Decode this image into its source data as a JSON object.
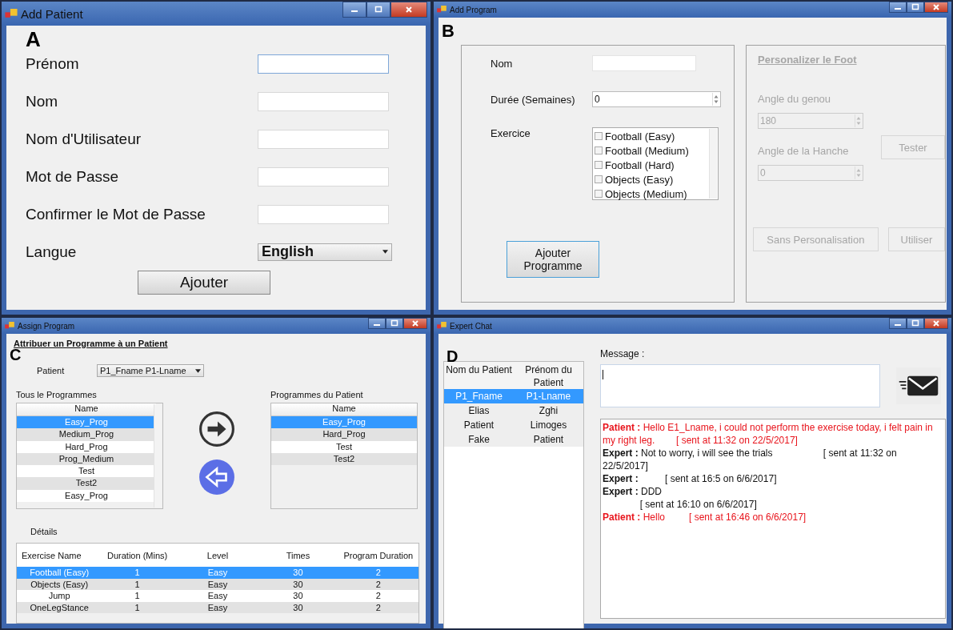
{
  "add_patient": {
    "window": {
      "title": "Add Patient"
    },
    "letter": "A",
    "fields": [
      {
        "label": "Prénom",
        "focused": true
      },
      {
        "label": "Nom",
        "focused": false
      },
      {
        "label": "Nom d'Utilisateur",
        "focused": false
      },
      {
        "label": "Mot de Passe",
        "focused": false
      },
      {
        "label": "Confirmer le Mot de Passe",
        "focused": false
      }
    ],
    "language": {
      "label": "Langue",
      "value": "English"
    },
    "button": "Ajouter"
  },
  "add_program": {
    "window": {
      "title": "Add Program"
    },
    "letter": "B",
    "name_label": "Nom",
    "duration": {
      "label": "Durée (Semaines)",
      "value": "0"
    },
    "exercises": {
      "label": "Exercice",
      "items": [
        {
          "label": "Football (Easy)",
          "checked": false
        },
        {
          "label": "Football (Medium)",
          "checked": false
        },
        {
          "label": "Football (Hard)",
          "checked": false
        },
        {
          "label": "Objects (Easy)",
          "checked": false
        },
        {
          "label": "Objects (Medium)",
          "checked": false
        }
      ]
    },
    "button": "Ajouter Programme",
    "custom": {
      "disabled": true,
      "title": "Personalizer le Foot",
      "knee_label": "Angle du genou",
      "knee_value": "180",
      "hip_label": "Angle de la Hanche",
      "hip_value": "0",
      "test_button": "Tester",
      "plain_button": "Sans Personalisation",
      "use_button": "Utiliser"
    }
  },
  "assign_program": {
    "window": {
      "title": "Assign Program"
    },
    "letter": "C",
    "heading": "Attribuer un Programme à un Patient",
    "patient": {
      "label": "Patient",
      "value": "P1_Fname P1-Lname"
    },
    "all_programs": {
      "title": "Tous le Programmes",
      "header": "Name",
      "rows": [
        {
          "name": "Easy_Prog",
          "selected": true
        },
        {
          "name": "Medium_Prog",
          "selected": false
        },
        {
          "name": "Hard_Prog",
          "selected": false
        },
        {
          "name": "Prog_Medium",
          "selected": false
        },
        {
          "name": "Test",
          "selected": false
        },
        {
          "name": "Test2",
          "selected": false
        },
        {
          "name": "Easy_Prog",
          "selected": false
        }
      ]
    },
    "patient_programs": {
      "title": "Programmes du Patient",
      "header": "Name",
      "rows": [
        {
          "name": "Easy_Prog",
          "selected": true
        },
        {
          "name": "Hard_Prog",
          "selected": false
        },
        {
          "name": "Test",
          "selected": false
        },
        {
          "name": "Test2",
          "selected": false
        }
      ]
    },
    "details": {
      "title": "Détails",
      "columns": [
        "Exercise Name",
        "Duration (Mins)",
        "Level",
        "Times",
        "Program Duration"
      ],
      "rows": [
        {
          "cells": [
            "Football (Easy)",
            "1",
            "Easy",
            "30",
            "2"
          ],
          "selected": true
        },
        {
          "cells": [
            "Objects (Easy)",
            "1",
            "Easy",
            "30",
            "2"
          ],
          "selected": false
        },
        {
          "cells": [
            "Jump",
            "1",
            "Easy",
            "30",
            "2"
          ],
          "selected": false
        },
        {
          "cells": [
            "OneLegStance",
            "1",
            "Easy",
            "30",
            "2"
          ],
          "selected": false
        }
      ]
    }
  },
  "expert_chat": {
    "window": {
      "title": "Expert Chat"
    },
    "letter": "D",
    "patients": {
      "columns": [
        "Nom du Patient",
        "Prénom du Patient"
      ],
      "rows": [
        {
          "cells": [
            "P1_Fname",
            "P1-Lname"
          ],
          "selected": true
        },
        {
          "cells": [
            "Elias",
            "Zghi"
          ],
          "selected": false
        },
        {
          "cells": [
            "Patient",
            "Limoges"
          ],
          "selected": false
        },
        {
          "cells": [
            "Fake",
            "Patient"
          ],
          "selected": false
        }
      ]
    },
    "message_label": "Message :",
    "messages": [
      {
        "kind": "patient",
        "text": "**Patient :** Hello E1_Lname, i could not perform the exercise today, i felt pain in my right leg.        [ sent at 11:32 on 22/5/2017]"
      },
      {
        "kind": "expert",
        "text": "**Expert :** Not to worry, i will see the trials                   [ sent at 11:32 on 22/5/2017]"
      },
      {
        "kind": "expert",
        "text": "**Expert :**          [ sent at 16:5 on 6/6/2017]"
      },
      {
        "kind": "expert",
        "text": "**Expert :** DDD\n              [ sent at 16:10 on 6/6/2017]"
      },
      {
        "kind": "patient",
        "text": "**Patient :** Hello         [ sent at 16:46 on 6/6/2017]"
      }
    ]
  }
}
